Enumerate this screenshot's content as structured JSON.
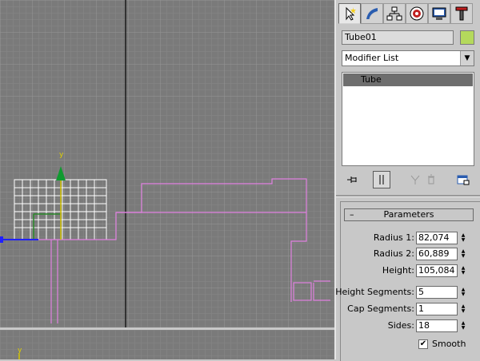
{
  "command_panel": {
    "tabs": [
      {
        "name": "create-tab-icon"
      },
      {
        "name": "modify-tab-icon"
      },
      {
        "name": "hierarchy-tab-icon"
      },
      {
        "name": "motion-tab-icon"
      },
      {
        "name": "display-tab-icon"
      },
      {
        "name": "utilities-tab-icon"
      }
    ],
    "object_name": "Tube01",
    "object_color": "#b4d95c",
    "modifier_list_label": "Modifier List",
    "stack_items": [
      "Tube"
    ],
    "parameters": {
      "title": "Parameters",
      "radius1_label": "Radius 1:",
      "radius1_value": "82,074",
      "radius2_label": "Radius 2:",
      "radius2_value": "60,889",
      "height_label": "Height:",
      "height_value": "105,084",
      "height_segments_label": "Height Segments:",
      "height_segments_value": "5",
      "cap_segments_label": "Cap Segments:",
      "cap_segments_value": "1",
      "sides_label": "Sides:",
      "sides_value": "18",
      "smooth_label": "Smooth",
      "smooth_checked": true
    }
  },
  "viewport": {
    "axis_label_y": "y",
    "axis_label_y_bottom": "y",
    "grid_color": "#8a8a8a",
    "background_color": "#7a7a7a",
    "object_color": "#e080e0"
  }
}
